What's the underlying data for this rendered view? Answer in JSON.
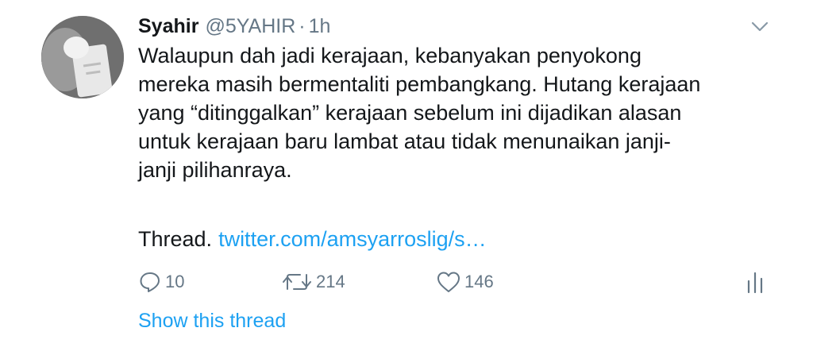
{
  "tweet": {
    "name": "Syahir",
    "handle": "@5YAHIR",
    "separator": "·",
    "time": "1h",
    "text": "Walaupun dah jadi kerajaan, kebanyakan penyokong\nmereka masih bermentaliti pembangkang. Hutang kerajaan\nyang “ditinggalkan” kerajaan sebelum ini dijadikan alasan\nuntuk kerajaan baru lambat atau tidak menunaikan janji-\njanji pilihanraya.",
    "thread_prefix": "Thread.",
    "thread_link": "twitter.com/amsyarroslig/s…",
    "replies": "10",
    "retweets": "214",
    "likes": "146",
    "show_thread": "Show this thread"
  },
  "icons": {
    "caret": "chevron-down-icon",
    "reply": "reply-icon",
    "retweet": "retweet-icon",
    "like": "heart-icon",
    "stats": "analytics-icon"
  },
  "colors": {
    "accent": "#1da1f2",
    "muted": "#657786",
    "text": "#14171a"
  }
}
